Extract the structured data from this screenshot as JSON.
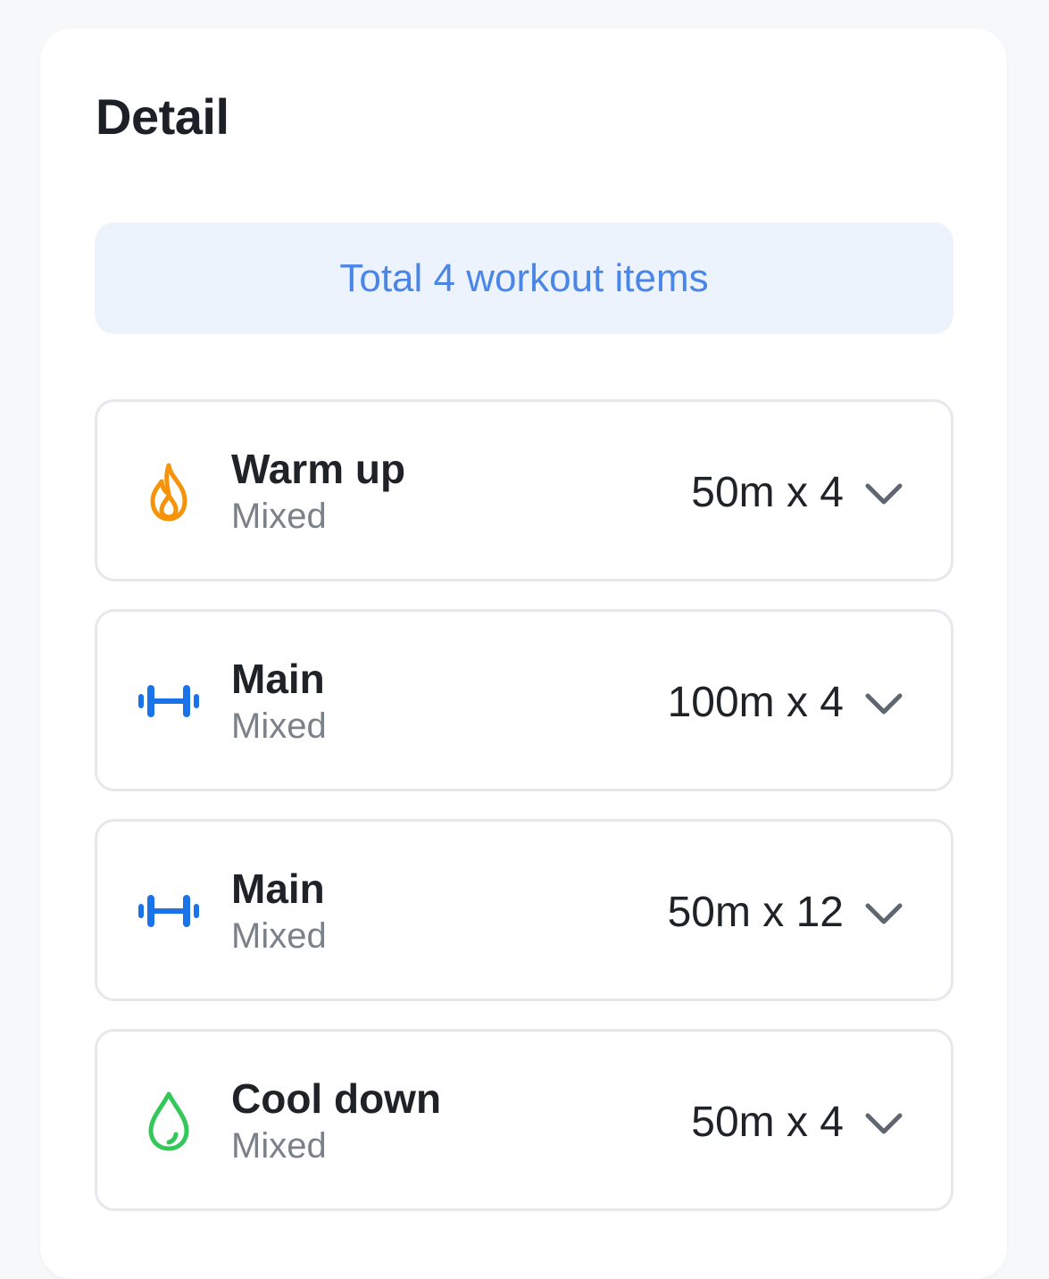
{
  "page": {
    "title": "Detail"
  },
  "summary": {
    "text": "Total 4 workout items"
  },
  "items": [
    {
      "name": "Warm up",
      "type": "Mixed",
      "volume": "50m x 4",
      "icon": "flame-icon",
      "icon_color": "#f5930b"
    },
    {
      "name": "Main",
      "type": "Mixed",
      "volume": "100m x 4",
      "icon": "dumbbell-icon",
      "icon_color": "#1a73e8"
    },
    {
      "name": "Main",
      "type": "Mixed",
      "volume": "50m x 12",
      "icon": "dumbbell-icon",
      "icon_color": "#1a73e8"
    },
    {
      "name": "Cool down",
      "type": "Mixed",
      "volume": "50m x 4",
      "icon": "droplet-icon",
      "icon_color": "#34c759"
    }
  ],
  "colors": {
    "accent": "#4a86e8",
    "summary_bg": "#edf3fd",
    "card_border": "#e6e8eb"
  }
}
